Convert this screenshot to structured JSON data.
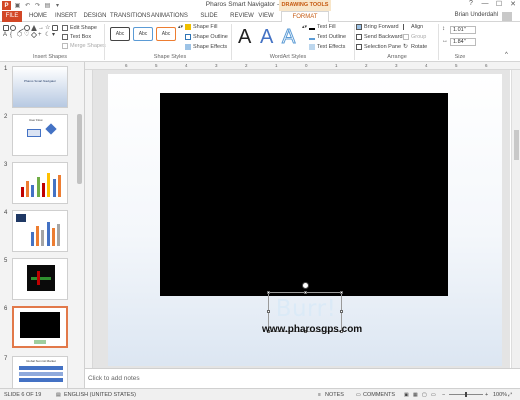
{
  "window": {
    "title": "Pharos Smart Navigator - PowerPoint",
    "context_tab_header": "DRAWING TOOLS",
    "controls": [
      "?",
      "—",
      "☐",
      "✕"
    ]
  },
  "quick_access": {
    "app_letter": "P"
  },
  "tabs": [
    "FILE",
    "HOME",
    "INSERT",
    "DESIGN",
    "TRANSITIONS",
    "ANIMATIONS",
    "SLIDE SHOW",
    "REVIEW",
    "VIEW",
    "FORMAT"
  ],
  "user": {
    "name": "Brian Underdahl"
  },
  "ribbon": {
    "insert_shapes": {
      "label": "Insert Shapes",
      "edit_shape": "Edit Shape",
      "text_box": "Text Box",
      "merge_shapes": "Merge Shapes"
    },
    "shape_styles": {
      "label": "Shape Styles",
      "presets": [
        "Abc",
        "Abc",
        "Abc"
      ],
      "fill": "Shape Fill",
      "outline": "Shape Outline",
      "effects": "Shape Effects"
    },
    "wordart_styles": {
      "label": "WordArt Styles",
      "letters": [
        "A",
        "A",
        "A"
      ],
      "text_fill": "Text Fill",
      "text_outline": "Text Outline",
      "text_effects": "Text Effects"
    },
    "arrange": {
      "label": "Arrange",
      "bring_forward": "Bring Forward",
      "send_backward": "Send Backward",
      "selection_pane": "Selection Pane",
      "align": "Align",
      "group": "Group",
      "rotate": "Rotate"
    },
    "size": {
      "label": "Size",
      "height": "1.01\"",
      "width": "1.84\""
    }
  },
  "ruler_ticks": [
    "6",
    "5",
    "4",
    "3",
    "2",
    "1",
    "0",
    "1",
    "2",
    "3",
    "4",
    "5",
    "6"
  ],
  "thumbnails": {
    "numbers": [
      "1",
      "2",
      "3",
      "4",
      "5",
      "6",
      "7"
    ],
    "selected": "6",
    "slide1_title": "Pharos Smart Navigator",
    "slide2_title": "User Flow",
    "slide7_title": "Global Summit Market"
  },
  "slide": {
    "headline": "Burr!",
    "url": "www.pharosgps.com"
  },
  "notes_placeholder": "Click to add notes",
  "status": {
    "slide_position": "SLIDE 6 OF 19",
    "language": "ENGLISH (UNITED STATES)",
    "notes": "NOTES",
    "comments": "COMMENTS",
    "zoom": "100%"
  }
}
